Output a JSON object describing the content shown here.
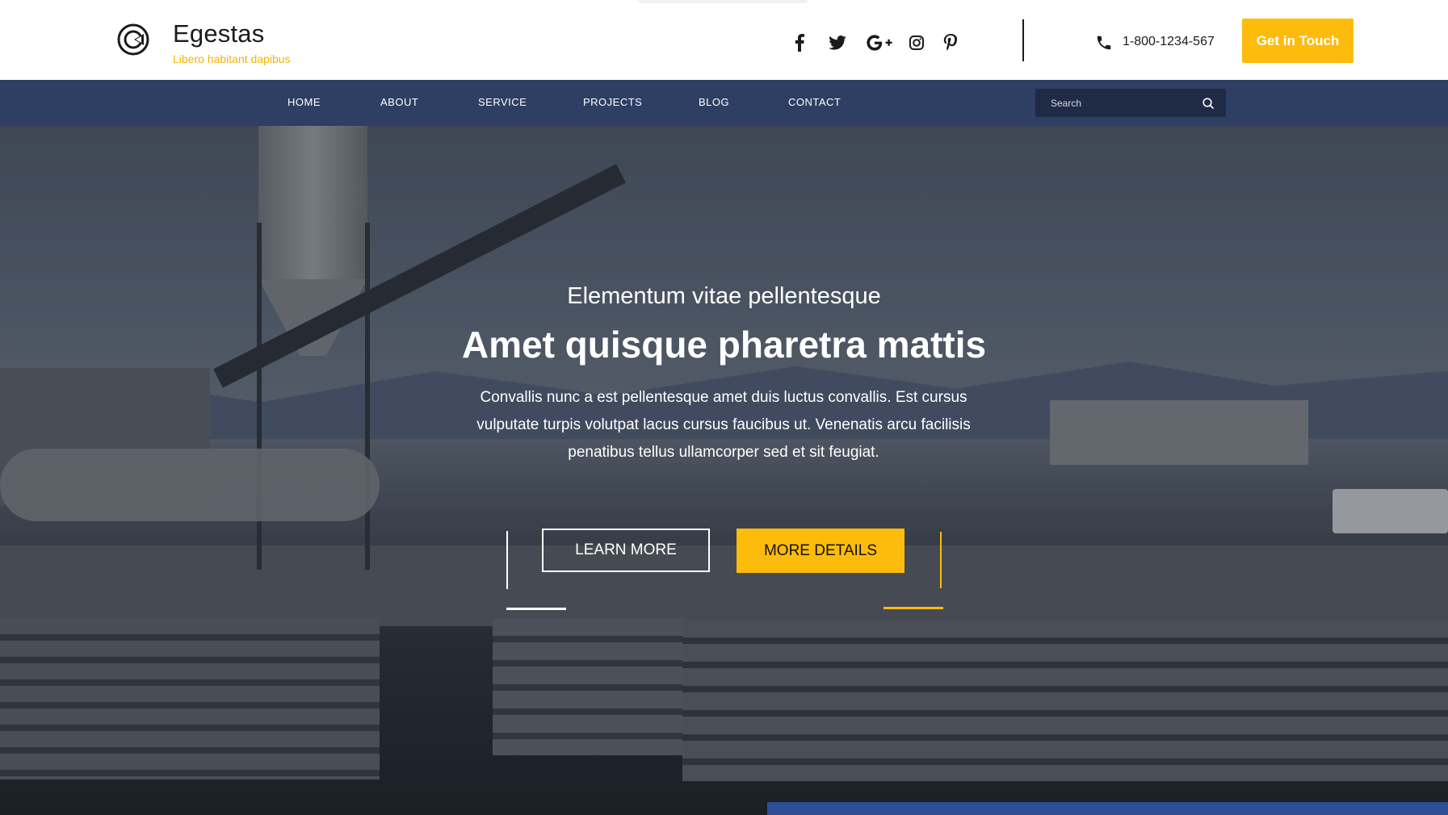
{
  "header": {
    "brand_name": "Egestas",
    "brand_tagline": "Libero habitant dapibus",
    "phone": "1-800-1234-567",
    "cta_label": "Get in Touch",
    "social": [
      "facebook-icon",
      "twitter-icon",
      "google-plus-icon",
      "instagram-icon",
      "pinterest-icon"
    ]
  },
  "nav": {
    "items": [
      {
        "label": "HOME"
      },
      {
        "label": "ABOUT"
      },
      {
        "label": "SERVICE"
      },
      {
        "label": "PROJECTS"
      },
      {
        "label": "BLOG"
      },
      {
        "label": "CONTACT"
      }
    ],
    "search_placeholder": "Search"
  },
  "hero": {
    "kicker": "Elementum vitae pellentesque",
    "title": "Amet quisque pharetra mattis",
    "body": "Convallis nunc a est pellentesque amet duis luctus convallis. Est cursus vulputate turpis volutpat lacus cursus faucibus ut. Venenatis arcu facilisis penatibus tellus ullamcorper sed et sit feugiat.",
    "learn_more_label": "LEARN MORE",
    "more_details_label": "MORE DETAILS"
  },
  "colors": {
    "accent": "#fdbc0b",
    "nav_bg": "#2f3e63",
    "search_bg": "#1f2a44"
  }
}
